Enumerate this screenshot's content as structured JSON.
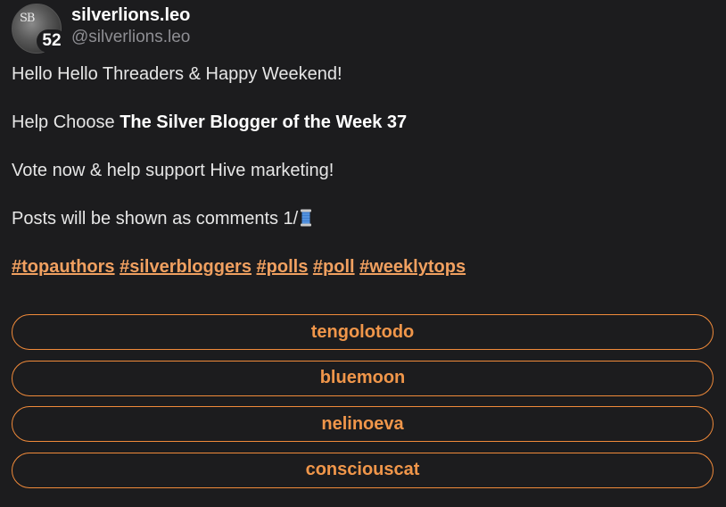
{
  "author": {
    "display_name": "silverlions.leo",
    "handle": "@silverlions.leo",
    "avatar_monogram": "SB",
    "badge_count": "52"
  },
  "post": {
    "line1": "Hello Hello Threaders & Happy Weekend!",
    "line2_prefix": "Help Choose ",
    "line2_bold": "The Silver Blogger of the Week 37",
    "line3": "Vote now & help support Hive marketing!",
    "line4": "Posts will be shown as comments 1/",
    "line4_emoji": "spool-of-thread-icon",
    "hashtags": [
      "#topauthors",
      "#silverbloggers",
      "#polls",
      "#poll",
      "#weeklytops"
    ]
  },
  "poll": {
    "options": [
      "tengolotodo",
      "bluemoon",
      "nelinoeva",
      "consciouscat"
    ]
  },
  "colors": {
    "background": "#1c1c1e",
    "accent": "#f08a3a",
    "hashtag": "#f0a060",
    "muted": "#8e8e93"
  }
}
